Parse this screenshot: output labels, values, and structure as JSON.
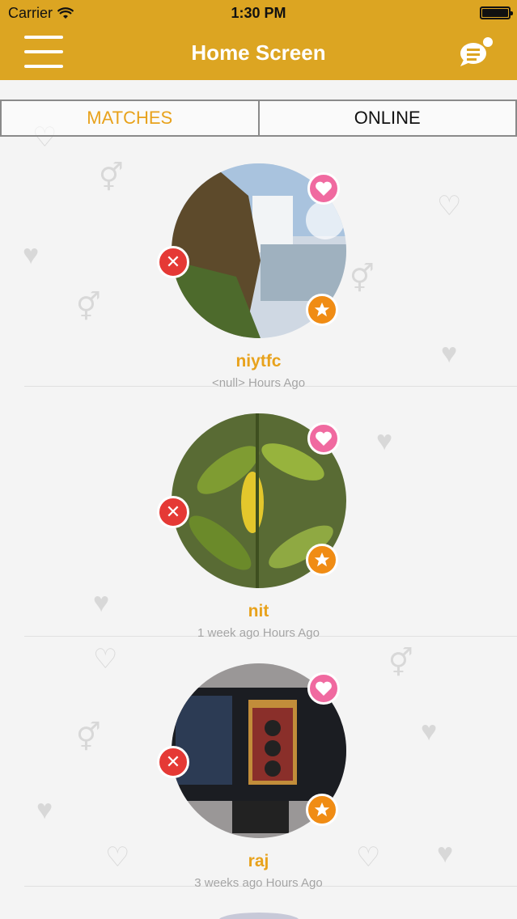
{
  "status_bar": {
    "carrier": "Carrier",
    "time": "1:30 PM"
  },
  "header": {
    "title": "Home Screen",
    "menu_icon": "hamburger-icon",
    "chat_icon": "chat-bubble-icon"
  },
  "tabs": [
    {
      "label": "MATCHES",
      "active": true
    },
    {
      "label": "ONLINE",
      "active": false
    }
  ],
  "matches": [
    {
      "name": "niytfc",
      "time_ago": "<null> Hours Ago"
    },
    {
      "name": "nit",
      "time_ago": "1 week ago Hours Ago"
    },
    {
      "name": "raj",
      "time_ago": "3 weeks ago Hours Ago"
    }
  ],
  "colors": {
    "header": "#dca522",
    "accent": "#e8a21c",
    "reject": "#e53935",
    "like": "#f06aa0",
    "star": "#f08c14"
  }
}
